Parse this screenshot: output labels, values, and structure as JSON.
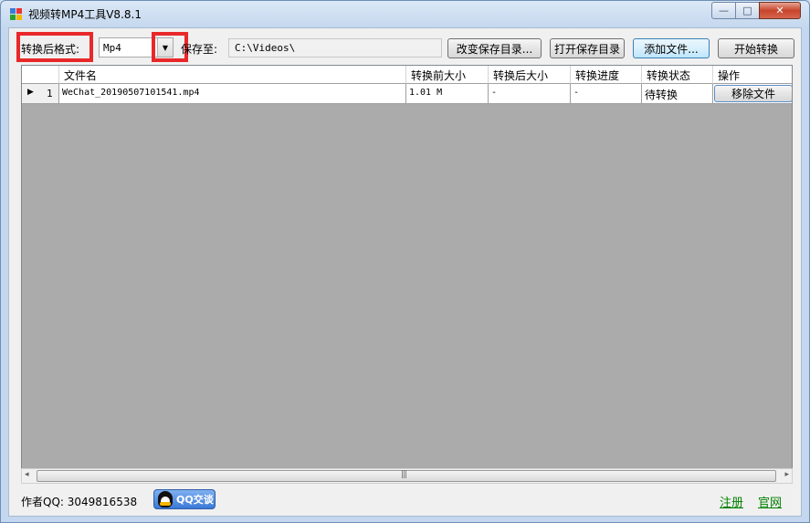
{
  "window": {
    "title": "视频转MP4工具V8.8.1",
    "minimize": "—",
    "maximize": "□",
    "close": "✕"
  },
  "toolbar": {
    "format_label": "转换后格式:",
    "format_value": "Mp4",
    "save_to_label": "保存至:",
    "save_path": "C:\\Videos\\",
    "change_dir_button": "改变保存目录...",
    "open_dir_button": "打开保存目录",
    "add_file_button": "添加文件...",
    "start_button": "开始转换"
  },
  "table": {
    "columns": [
      "文件名",
      "转换前大小",
      "转换后大小",
      "转换进度",
      "转换状态",
      "操作"
    ],
    "rows": [
      {
        "index": "1",
        "filename": "WeChat_20190507101541.mp4",
        "size_before": "1.01 M",
        "size_after": "-",
        "progress": "-",
        "status": "待转换",
        "action": "移除文件"
      }
    ]
  },
  "footer": {
    "author_qq": "作者QQ: 3049816538",
    "qq_button": "QQ交谈",
    "register_link": "注册",
    "website_link": "官网"
  },
  "colors": {
    "highlight_box": "#e8282a",
    "grid_background": "#ababab",
    "link": "#008000"
  }
}
